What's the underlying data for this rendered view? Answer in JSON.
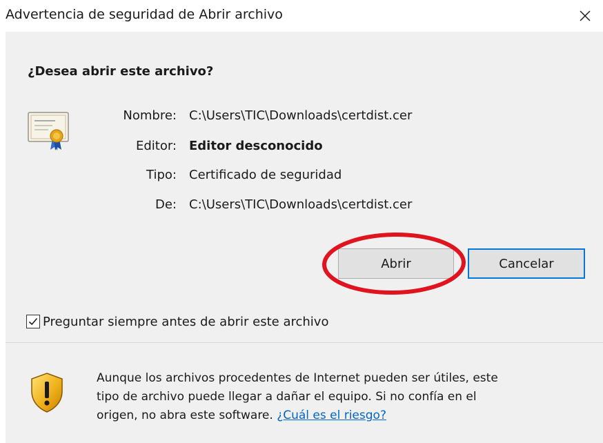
{
  "window": {
    "title": "Advertencia de seguridad de Abrir archivo",
    "close_glyph": "✕"
  },
  "dialog": {
    "question": "¿Desea abrir este archivo?",
    "file_icon": "certificate-icon",
    "fields": [
      {
        "label": "Nombre:",
        "value": "C:\\Users\\TIC\\Downloads\\certdist.cer"
      },
      {
        "label": "Editor:",
        "value": "Editor desconocido"
      },
      {
        "label": "Tipo:",
        "value": "Certificado de seguridad"
      },
      {
        "label": "De:",
        "value": "C:\\Users\\TIC\\Downloads\\certdist.cer"
      }
    ],
    "open_label": "Abrir",
    "cancel_label": "Cancelar",
    "highlight_color": "#e0141e",
    "checkbox": {
      "label": "Preguntar siempre antes de abrir este archivo",
      "checked": true
    }
  },
  "footer": {
    "icon": "warning-shield-icon",
    "lines": [
      "Aunque los archivos procedentes de Internet pueden ser útiles, este",
      "tipo de archivo puede llegar a dañar el equipo. Si no confía en el",
      "origen, no abra este software."
    ],
    "link_label": "¿Cuál es el riesgo?",
    "link_color": "#0066cc"
  }
}
